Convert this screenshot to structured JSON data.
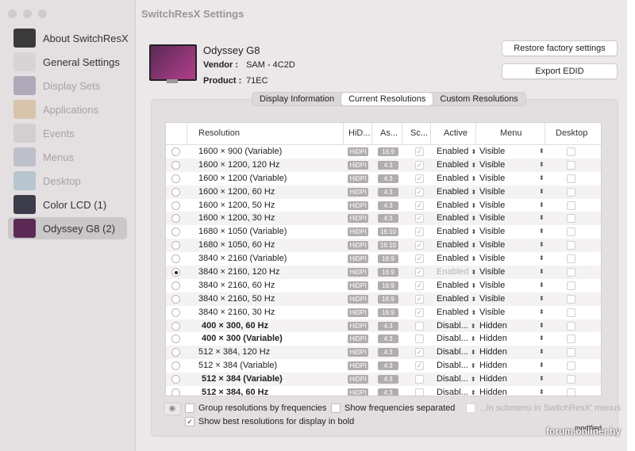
{
  "window": {
    "title": "SwitchResX Settings"
  },
  "sidebar": {
    "items": [
      {
        "label": "About SwitchResX",
        "icon": "switchresx-app-icon",
        "dim": false,
        "selected": false
      },
      {
        "label": "General Settings",
        "icon": "switch-toggle-icon",
        "dim": false,
        "selected": false
      },
      {
        "label": "Display Sets",
        "icon": "display-sets-icon",
        "dim": true,
        "selected": false
      },
      {
        "label": "Applications",
        "icon": "applications-icon",
        "dim": true,
        "selected": false
      },
      {
        "label": "Events",
        "icon": "clock-icon",
        "dim": true,
        "selected": false
      },
      {
        "label": "Menus",
        "icon": "menus-icon",
        "dim": true,
        "selected": false
      },
      {
        "label": "Desktop",
        "icon": "desktop-icon",
        "dim": true,
        "selected": false
      },
      {
        "label": "Color LCD (1)",
        "icon": "laptop-icon",
        "dim": false,
        "selected": false
      },
      {
        "label": "Odyssey G8 (2)",
        "icon": "monitor-icon",
        "dim": false,
        "selected": true
      }
    ]
  },
  "device": {
    "name": "Odyssey G8",
    "vendor_label": "Vendor :",
    "vendor": "SAM - 4C2D",
    "product_label": "Product :",
    "product": "71EC"
  },
  "buttons": {
    "restore": "Restore factory settings",
    "export": "Export EDID"
  },
  "tabs": [
    {
      "label": "Display Information",
      "active": false
    },
    {
      "label": "Current Resolutions",
      "active": true
    },
    {
      "label": "Custom Resolutions",
      "active": false
    }
  ],
  "table": {
    "columns": [
      "Resolution",
      "HiD...",
      "As...",
      "Sc...",
      "Active",
      "Menu",
      "Desktop"
    ],
    "rows": [
      {
        "res": "1600 × 900 (Variable)",
        "bold": false,
        "radio": false,
        "hidpi": "HiDPI",
        "aspect": "16:9",
        "scaled": true,
        "active": "Enabled",
        "menu": "Visible"
      },
      {
        "res": "1600 × 1200, 120 Hz",
        "bold": false,
        "radio": false,
        "hidpi": "HiDPI",
        "aspect": "4:3",
        "scaled": true,
        "active": "Enabled",
        "menu": "Visible"
      },
      {
        "res": "1600 × 1200 (Variable)",
        "bold": false,
        "radio": false,
        "hidpi": "HiDPI",
        "aspect": "4:3",
        "scaled": true,
        "active": "Enabled",
        "menu": "Visible"
      },
      {
        "res": "1600 × 1200, 60 Hz",
        "bold": false,
        "radio": false,
        "hidpi": "HiDPI",
        "aspect": "4:3",
        "scaled": true,
        "active": "Enabled",
        "menu": "Visible"
      },
      {
        "res": "1600 × 1200, 50 Hz",
        "bold": false,
        "radio": false,
        "hidpi": "HiDPI",
        "aspect": "4:3",
        "scaled": true,
        "active": "Enabled",
        "menu": "Visible"
      },
      {
        "res": "1600 × 1200, 30 Hz",
        "bold": false,
        "radio": false,
        "hidpi": "HiDPI",
        "aspect": "4:3",
        "scaled": true,
        "active": "Enabled",
        "menu": "Visible"
      },
      {
        "res": "1680 × 1050 (Variable)",
        "bold": false,
        "radio": false,
        "hidpi": "HiDPI",
        "aspect": "16:10",
        "scaled": true,
        "active": "Enabled",
        "menu": "Visible"
      },
      {
        "res": "1680 × 1050, 60 Hz",
        "bold": false,
        "radio": false,
        "hidpi": "HiDPI",
        "aspect": "16:10",
        "scaled": true,
        "active": "Enabled",
        "menu": "Visible"
      },
      {
        "res": "3840 × 2160 (Variable)",
        "bold": false,
        "radio": false,
        "hidpi": "HiDPI",
        "aspect": "16:9",
        "scaled": true,
        "active": "Enabled",
        "menu": "Visible"
      },
      {
        "res": "3840 × 2160, 120 Hz",
        "bold": false,
        "radio": true,
        "hidpi": "HiDPI",
        "aspect": "16:9",
        "scaled": true,
        "active": "Enabled",
        "activeDim": true,
        "menu": "Visible"
      },
      {
        "res": "3840 × 2160, 60 Hz",
        "bold": false,
        "radio": false,
        "hidpi": "HiDPI",
        "aspect": "16:9",
        "scaled": true,
        "active": "Enabled",
        "menu": "Visible"
      },
      {
        "res": "3840 × 2160, 50 Hz",
        "bold": false,
        "radio": false,
        "hidpi": "HiDPI",
        "aspect": "16:9",
        "scaled": true,
        "active": "Enabled",
        "menu": "Visible"
      },
      {
        "res": "3840 × 2160, 30 Hz",
        "bold": false,
        "radio": false,
        "hidpi": "HiDPI",
        "aspect": "16:9",
        "scaled": true,
        "active": "Enabled",
        "menu": "Visible"
      },
      {
        "res": "400 × 300, 60 Hz",
        "bold": true,
        "radio": false,
        "hidpi": "HiDPI",
        "aspect": "4:3",
        "scaled": false,
        "active": "Disabl...",
        "menu": "Hidden"
      },
      {
        "res": "400 × 300 (Variable)",
        "bold": true,
        "radio": false,
        "hidpi": "HiDPI",
        "aspect": "4:3",
        "scaled": false,
        "active": "Disabl...",
        "menu": "Hidden"
      },
      {
        "res": "512 × 384, 120 Hz",
        "bold": false,
        "radio": false,
        "hidpi": "HiDPI",
        "aspect": "4:3",
        "scaled": true,
        "active": "Disabl...",
        "menu": "Hidden"
      },
      {
        "res": "512 × 384 (Variable)",
        "bold": false,
        "radio": false,
        "hidpi": "HiDPI",
        "aspect": "4:3",
        "scaled": true,
        "active": "Disabl...",
        "menu": "Hidden"
      },
      {
        "res": "512 × 384 (Variable)",
        "bold": true,
        "radio": false,
        "hidpi": "HiDPI",
        "aspect": "4:3",
        "scaled": false,
        "active": "Disabl...",
        "menu": "Hidden"
      },
      {
        "res": "512 × 384, 60 Hz",
        "bold": true,
        "radio": false,
        "hidpi": "HiDPI",
        "aspect": "4:3",
        "scaled": false,
        "active": "Disabl...",
        "menu": "Hidden"
      }
    ]
  },
  "options": {
    "group": {
      "label": "Group resolutions by frequencies",
      "checked": false
    },
    "separate": {
      "label": "Show frequencies separated",
      "checked": false
    },
    "submenu": {
      "label": "...in submenu in SwitchResX' menus",
      "checked": false
    },
    "bold": {
      "label": "Show best resolutions for display in bold",
      "checked": true
    }
  },
  "status": {
    "modified": "modified"
  },
  "watermark": "forum.onliner.by",
  "colors": {
    "badge": "#b1acae",
    "selected": "#cbc6c8",
    "window": "#ece7e8"
  }
}
